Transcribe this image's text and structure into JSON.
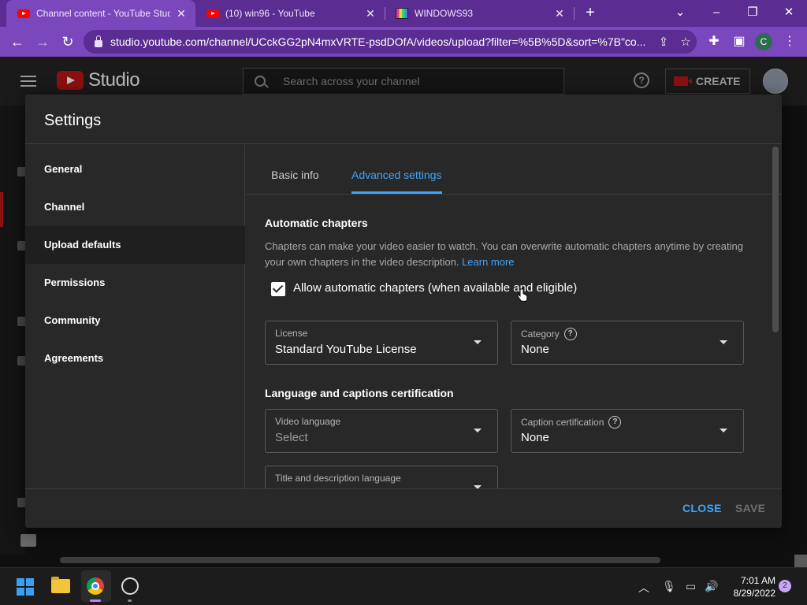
{
  "browser": {
    "tabs": [
      {
        "title": "Channel content - YouTube Studio",
        "icon": "youtube-icon",
        "active": true
      },
      {
        "title": "(10) win96 - YouTube",
        "icon": "youtube-icon",
        "active": false
      },
      {
        "title": "WINDOWS93",
        "icon": "windows93-icon",
        "active": false
      }
    ],
    "url": "studio.youtube.com/channel/UCckGG2pN4mxVRTE-psdDOfA/videos/upload?filter=%5B%5D&sort=%7B\"co...",
    "profile_initial": "C",
    "theme_color": "#7a47bd"
  },
  "studio": {
    "logo_text": "Studio",
    "search_placeholder": "Search across your channel",
    "create_label": "CREATE",
    "help_glyph": "?"
  },
  "settings": {
    "title": "Settings",
    "nav": [
      {
        "label": "General"
      },
      {
        "label": "Channel"
      },
      {
        "label": "Upload defaults",
        "selected": true
      },
      {
        "label": "Permissions"
      },
      {
        "label": "Community"
      },
      {
        "label": "Agreements"
      }
    ],
    "tabs": {
      "basic": "Basic info",
      "advanced": "Advanced settings",
      "active": "advanced"
    },
    "chapters": {
      "title": "Automatic chapters",
      "description": "Chapters can make your video easier to watch. You can overwrite automatic chapters anytime by creating your own chapters in the video description.",
      "learn_more": "Learn more",
      "checkbox_label": "Allow automatic chapters (when available and eligible)",
      "checked": true
    },
    "license": {
      "label": "License",
      "value": "Standard YouTube License"
    },
    "category": {
      "label": "Category",
      "value": "None"
    },
    "language_section_title": "Language and captions certification",
    "video_language": {
      "label": "Video language",
      "value": "Select"
    },
    "caption_certification": {
      "label": "Caption certification",
      "value": "None"
    },
    "title_desc_language": {
      "label": "Title and description language"
    },
    "footer": {
      "close": "CLOSE",
      "save": "SAVE"
    },
    "accent_color": "#3ea6ff"
  },
  "taskbar": {
    "time": "7:01 AM",
    "date": "8/29/2022",
    "notifications": "2"
  }
}
